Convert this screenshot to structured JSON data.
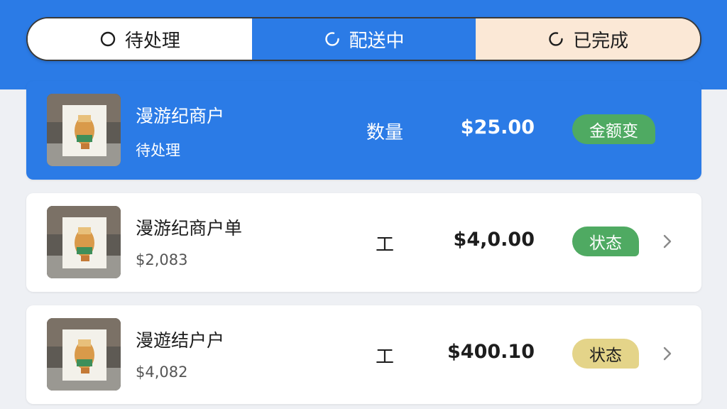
{
  "tabs": [
    {
      "label": "待处理",
      "icon": "circle-icon"
    },
    {
      "label": "配送中",
      "icon": "loading-icon"
    },
    {
      "label": "已完成",
      "icon": "loading-icon"
    }
  ],
  "orders": [
    {
      "merchant": "漫游纪商户",
      "subline": "待处理",
      "qty": "数量",
      "amount": "$25.00",
      "badge": "金额变",
      "badge_color": "#4faa62"
    },
    {
      "merchant": "漫游纪商户单",
      "subline": "$2,083",
      "qty": "工",
      "amount": "$4,0.00",
      "badge": "状态",
      "badge_color": "#4faa62"
    },
    {
      "merchant": "漫遊结户户",
      "subline": "$4,082",
      "qty": "工",
      "amount": "$400.10",
      "badge": "状态",
      "badge_color": "#e4d489"
    }
  ],
  "colors": {
    "primary": "#2b7be6",
    "green": "#4faa62",
    "yellow": "#e4d489",
    "peach": "#fbe8d6"
  }
}
